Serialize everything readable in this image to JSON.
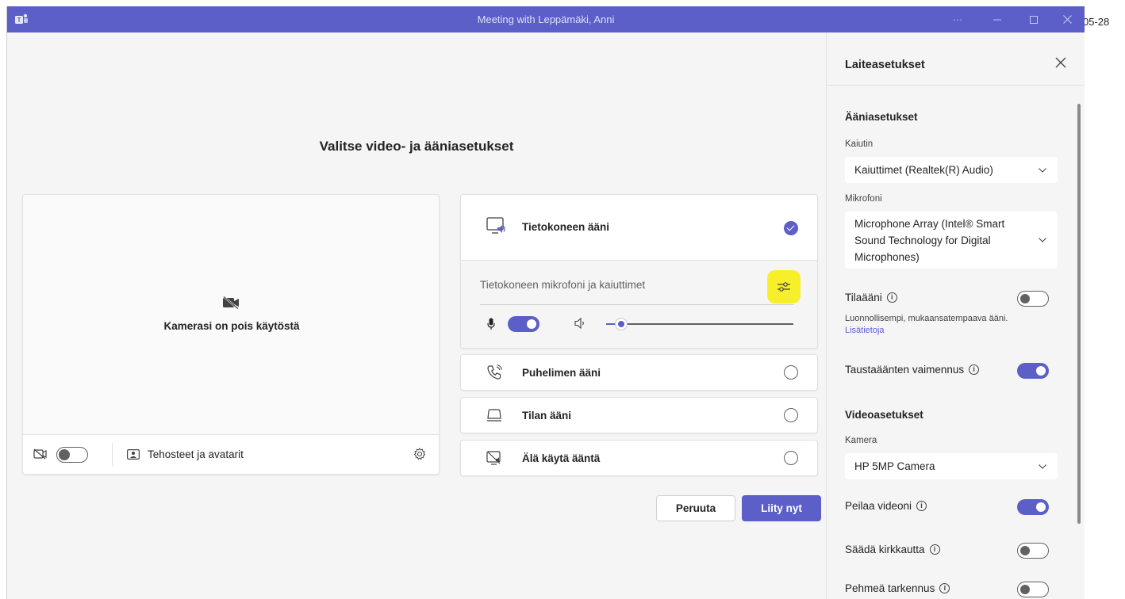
{
  "titlebar": {
    "title": "Meeting with Leppämäki, Anni",
    "more": "···"
  },
  "outside_text": "05-28",
  "main": {
    "heading": "Valitse video- ja ääniasetukset",
    "camera_off_text": "Kamerasi on pois käytöstä",
    "camera_toggle_on": false,
    "effects_label": "Tehosteet ja avatarit"
  },
  "audio_options": [
    {
      "label": "Tietokoneen ääni",
      "selected": true,
      "icon": "computer-audio-icon"
    },
    {
      "label": "Puhelimen ääni",
      "selected": false,
      "icon": "phone-audio-icon"
    },
    {
      "label": "Tilan ääni",
      "selected": false,
      "icon": "room-audio-icon"
    },
    {
      "label": "Älä käytä ääntä",
      "selected": false,
      "icon": "no-audio-icon"
    }
  ],
  "computer_audio": {
    "subtitle": "Tietokoneen mikrofoni ja kaiuttimet",
    "mic_on": true,
    "volume_fraction": 0.08
  },
  "buttons": {
    "cancel": "Peruuta",
    "join": "Liity nyt"
  },
  "settings_panel": {
    "title": "Laiteasetukset",
    "audio_section": "Ääniasetukset",
    "speaker_label": "Kaiutin",
    "speaker_value": "Kaiuttimet (Realtek(R) Audio)",
    "mic_label": "Mikrofoni",
    "mic_value_line1": "Microphone Array (Intel® Smart",
    "mic_value_line2": "Sound Technology for Digital",
    "mic_value_line3": "Microphones)",
    "spatial_audio": "Tilaääni",
    "spatial_audio_on": false,
    "spatial_desc": "Luonnollisempi, mukaansatempaava ääni.",
    "learn_more": "Lisätietoja",
    "noise_suppression": "Taustaäänten vaimennus",
    "noise_suppression_on": true,
    "video_section": "Videoasetukset",
    "camera_label": "Kamera",
    "camera_value": "HP 5MP Camera",
    "mirror_video": "Peilaa videoni",
    "mirror_video_on": true,
    "brightness": "Säädä kirkkautta",
    "brightness_on": false,
    "soft_focus": "Pehmeä tarkennus",
    "soft_focus_on": false
  },
  "colors": {
    "accent": "#5b5fc7",
    "highlight": "#f7ef2a"
  }
}
